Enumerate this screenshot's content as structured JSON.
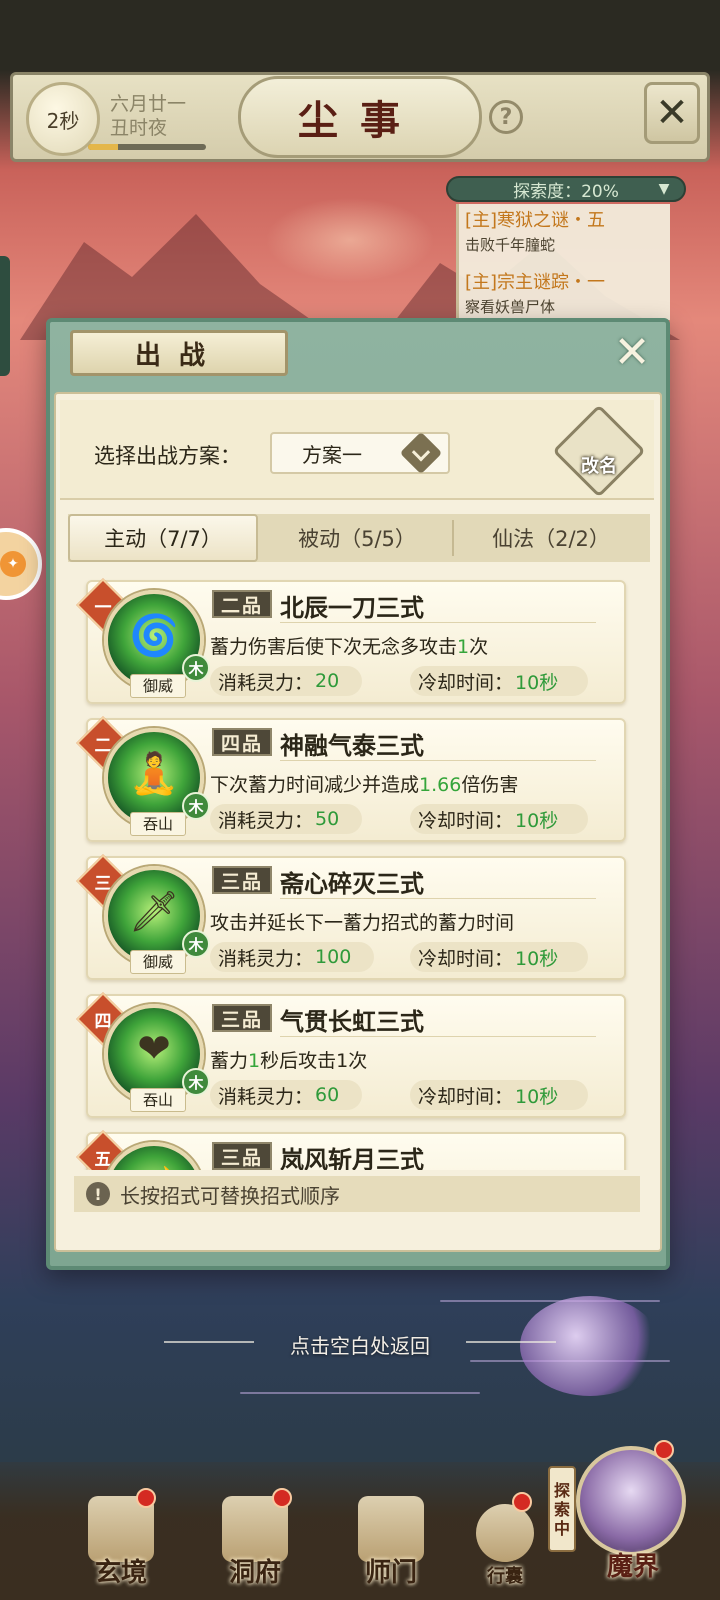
{
  "header": {
    "timer": "2秒",
    "date_line1": "六月廿一",
    "date_line2": "丑时夜",
    "time_progress": 0.25,
    "title": "尘事",
    "help_label": "?"
  },
  "tracker": {
    "explore_label": "探索度：20%",
    "quests": [
      {
        "title": "[主]寒狱之谜・五",
        "desc": "击败千年朣蛇"
      },
      {
        "title": "[主]宗主谜踪・一",
        "desc": "察看妖兽尸体"
      }
    ]
  },
  "dialog": {
    "title": "出战",
    "plan_label": "选择出战方案：",
    "plan_value": "方案一",
    "rename_label": "改名",
    "tabs": [
      {
        "label": "主动（7/7）"
      },
      {
        "label": "被动（5/5）"
      },
      {
        "label": "仙法（2/2）"
      }
    ],
    "skills": [
      {
        "rank": "一",
        "grade": "二品",
        "name": "北辰一刀三式",
        "desc_pre": "蓄力伤害后使下次无念多攻击",
        "desc_num": "1",
        "desc_post": "次",
        "school": "御威",
        "element": "木",
        "cost_label": "消耗灵力：",
        "cost": "20",
        "cd_label": "冷却时间：",
        "cd": "10秒"
      },
      {
        "rank": "二",
        "grade": "四品",
        "name": "神融气泰三式",
        "desc_pre": "下次蓄力时间减少并造成",
        "desc_num": "1.66",
        "desc_post": "倍伤害",
        "school": "吞山",
        "element": "木",
        "cost_label": "消耗灵力：",
        "cost": "50",
        "cd_label": "冷却时间：",
        "cd": "10秒"
      },
      {
        "rank": "三",
        "grade": "三品",
        "name": "斋心碎灭三式",
        "desc_pre": "攻击并延长下一蓄力招式的蓄力时间",
        "desc_num": "",
        "desc_post": "",
        "school": "御威",
        "element": "木",
        "cost_label": "消耗灵力：",
        "cost": "100",
        "cd_label": "冷却时间：",
        "cd": "10秒"
      },
      {
        "rank": "四",
        "grade": "三品",
        "name": "气贯长虹三式",
        "desc_pre": "蓄力",
        "desc_num": "1",
        "desc_post": "秒后攻击1次",
        "school": "吞山",
        "element": "木",
        "cost_label": "消耗灵力：",
        "cost": "60",
        "cd_label": "冷却时间：",
        "cd": "10秒"
      },
      {
        "rank": "五",
        "grade": "三品",
        "name": "岚风斩月三式"
      }
    ],
    "tip": "长按招式可替换招式顺序"
  },
  "return_hint": "点击空白处返回",
  "bottom_nav": [
    {
      "label": "玄境"
    },
    {
      "label": "洞府"
    },
    {
      "label": "师门"
    },
    {
      "label": "行囊"
    }
  ],
  "explore_status": "探索中",
  "demon_realm_label": "魔界"
}
